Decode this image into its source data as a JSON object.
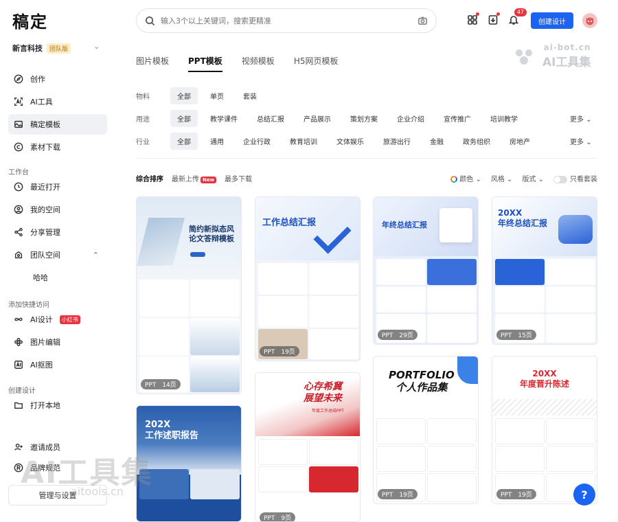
{
  "sidebar": {
    "logo": "稿定",
    "team_name": "新言科技",
    "team_tag": "团队版",
    "items": [
      {
        "label": "创作"
      },
      {
        "label": "AI工具"
      },
      {
        "label": "稿定模板"
      },
      {
        "label": "素材下载"
      }
    ],
    "workspace_label": "工作台",
    "workspace_items": [
      {
        "label": "最近打开"
      },
      {
        "label": "我的空间"
      },
      {
        "label": "分享管理"
      },
      {
        "label": "团队空间"
      },
      {
        "label": "哈哈"
      }
    ],
    "quick_label": "添加快捷访问",
    "quick_items": [
      {
        "label": "AI设计",
        "badge": "小红书"
      },
      {
        "label": "图片编辑"
      },
      {
        "label": "AI抠图"
      }
    ],
    "create_label": "创建设计",
    "create_items": [
      {
        "label": "打开本地"
      }
    ],
    "bottom_items": [
      {
        "label": "邀请成员"
      },
      {
        "label": "品牌规范"
      }
    ],
    "manage_label": "管理与设置"
  },
  "header": {
    "search_placeholder": "输入3个以上关键词，搜索更精准",
    "notif_count": "47",
    "create_button": "创建设计",
    "watermark_top1": "ai-bot.cn",
    "watermark_top2": "AI工具集"
  },
  "tabs": [
    "图片模板",
    "PPT模板",
    "视频模板",
    "H5网页模板"
  ],
  "filters": {
    "row1": {
      "label": "物料",
      "chips": [
        "全部",
        "单页",
        "套装"
      ]
    },
    "row2": {
      "label": "用途",
      "chips": [
        "全部",
        "教学课件",
        "总结汇报",
        "产品展示",
        "策划方案",
        "企业介绍",
        "宣传推广",
        "培训教学"
      ],
      "more": "更多"
    },
    "row3": {
      "label": "行业",
      "chips": [
        "全部",
        "通用",
        "企业行政",
        "教育培训",
        "文体娱乐",
        "旅游出行",
        "金融",
        "政务组织",
        "房地产"
      ],
      "more": "更多"
    }
  },
  "sort": {
    "options": [
      "综合排序",
      "最新上传",
      "最多下载"
    ],
    "new_tag": "New",
    "right": [
      "颜色",
      "风格",
      "版式"
    ],
    "only_set": "只看套装"
  },
  "cards": [
    {
      "title": "简约新拟态风\n论文答辩模板",
      "pill": "PPT　14页"
    },
    {
      "title": "工作总结汇报",
      "pill": "PPT　19页"
    },
    {
      "title": "年终总结汇报",
      "pill": "PPT　29页"
    },
    {
      "title": "20XX\n年终总结汇报",
      "pill": "PPT　15页"
    },
    {
      "title": "202X\n工作述职报告",
      "pill": ""
    },
    {
      "title": "心存希冀\n展望未来",
      "subtitle": "年度工作总结PPT",
      "pill": "PPT　9页"
    },
    {
      "title": "PORTFOLIO\n个人作品集",
      "pill": "PPT　19页"
    },
    {
      "title": "20XX\n年度晋升陈述",
      "pill": "PPT　19页"
    }
  ],
  "watermark": {
    "big": "AI工具集",
    "small": "aitools.cn"
  },
  "colors": {
    "accent": "#1c63f2",
    "danger": "#e8343e"
  }
}
